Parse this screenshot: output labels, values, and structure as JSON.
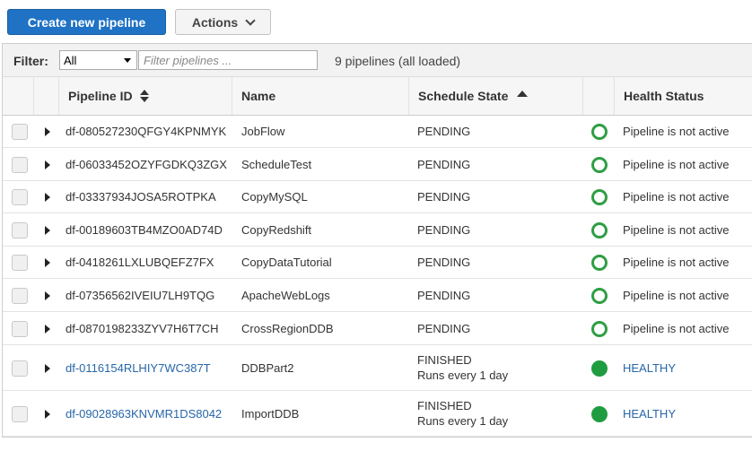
{
  "toolbar": {
    "create_label": "Create new pipeline",
    "actions_label": "Actions"
  },
  "filter": {
    "label": "Filter:",
    "selected": "All",
    "placeholder": "Filter pipelines ...",
    "count_text": "9 pipelines (all loaded)"
  },
  "columns": {
    "pipeline_id": "Pipeline ID",
    "name": "Name",
    "schedule_state": "Schedule State",
    "health_status": "Health Status"
  },
  "rows": [
    {
      "id": "df-080527230QFGY4KPNMYK",
      "name": "JobFlow",
      "state": "PENDING",
      "state2": "",
      "health": "Pipeline is not active",
      "healthy": false
    },
    {
      "id": "df-06033452OZYFGDKQ3ZGX",
      "name": "ScheduleTest",
      "state": "PENDING",
      "state2": "",
      "health": "Pipeline is not active",
      "healthy": false
    },
    {
      "id": "df-03337934JOSA5ROTPKA",
      "name": "CopyMySQL",
      "state": "PENDING",
      "state2": "",
      "health": "Pipeline is not active",
      "healthy": false
    },
    {
      "id": "df-00189603TB4MZO0AD74D",
      "name": "CopyRedshift",
      "state": "PENDING",
      "state2": "",
      "health": "Pipeline is not active",
      "healthy": false
    },
    {
      "id": "df-0418261LXLUBQEFZ7FX",
      "name": "CopyDataTutorial",
      "state": "PENDING",
      "state2": "",
      "health": "Pipeline is not active",
      "healthy": false
    },
    {
      "id": "df-07356562IVEIU7LH9TQG",
      "name": "ApacheWebLogs",
      "state": "PENDING",
      "state2": "",
      "health": "Pipeline is not active",
      "healthy": false
    },
    {
      "id": "df-0870198233ZYV7H6T7CH",
      "name": "CrossRegionDDB",
      "state": "PENDING",
      "state2": "",
      "health": "Pipeline is not active",
      "healthy": false
    },
    {
      "id": "df-0116154RLHIY7WC387T",
      "name": "DDBPart2",
      "state": "FINISHED",
      "state2": "Runs every 1 day",
      "health": "HEALTHY",
      "healthy": true
    },
    {
      "id": "df-09028963KNVMR1DS8042",
      "name": "ImportDDB",
      "state": "FINISHED",
      "state2": "Runs every 1 day",
      "health": "HEALTHY",
      "healthy": true
    }
  ]
}
